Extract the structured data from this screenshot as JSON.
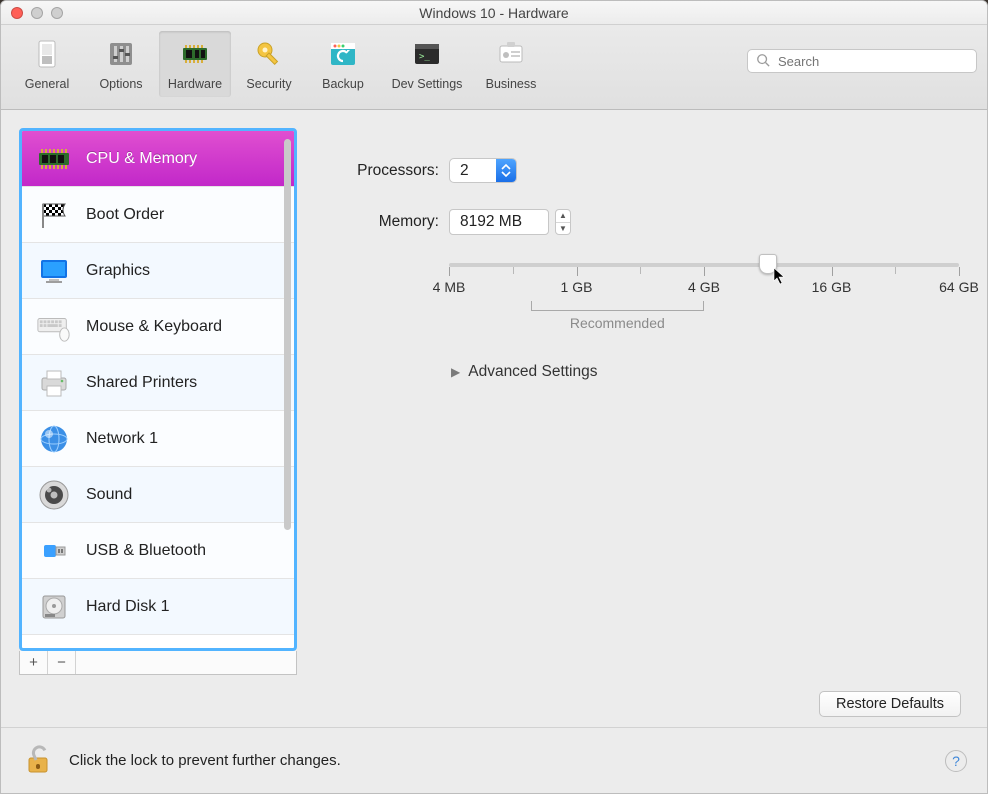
{
  "window": {
    "title": "Windows 10 - Hardware"
  },
  "toolbar": {
    "items": [
      {
        "label": "General",
        "icon": "switch-icon"
      },
      {
        "label": "Options",
        "icon": "sliders-icon"
      },
      {
        "label": "Hardware",
        "icon": "chip-icon",
        "selected": true
      },
      {
        "label": "Security",
        "icon": "key-icon"
      },
      {
        "label": "Backup",
        "icon": "backup-icon"
      },
      {
        "label": "Dev Settings",
        "icon": "terminal-icon"
      },
      {
        "label": "Business",
        "icon": "badge-icon"
      }
    ],
    "search_placeholder": "Search"
  },
  "sidebar": {
    "items": [
      {
        "label": "CPU & Memory",
        "icon": "chip-icon",
        "selected": true
      },
      {
        "label": "Boot Order",
        "icon": "flag-icon"
      },
      {
        "label": "Graphics",
        "icon": "monitor-icon"
      },
      {
        "label": "Mouse & Keyboard",
        "icon": "keyboard-icon"
      },
      {
        "label": "Shared Printers",
        "icon": "printer-icon"
      },
      {
        "label": "Network 1",
        "icon": "globe-icon"
      },
      {
        "label": "Sound",
        "icon": "speaker-icon"
      },
      {
        "label": "USB & Bluetooth",
        "icon": "usb-icon"
      },
      {
        "label": "Hard Disk 1",
        "icon": "hdd-icon"
      }
    ],
    "add_label": "+",
    "remove_label": "−"
  },
  "main": {
    "processors_label": "Processors:",
    "processors_value": "2",
    "memory_label": "Memory:",
    "memory_value": "8192 MB",
    "slider": {
      "ticks": [
        {
          "pos": 0,
          "label": "4 MB",
          "value_mb": 4
        },
        {
          "pos": 0.25,
          "label": "1 GB",
          "value_mb": 1024
        },
        {
          "pos": 0.5,
          "label": "4 GB",
          "value_mb": 4096
        },
        {
          "pos": 0.75,
          "label": "16 GB",
          "value_mb": 16384
        },
        {
          "pos": 1.0,
          "label": "64 GB",
          "value_mb": 65536
        }
      ],
      "thumb_pos": 0.625,
      "recommended": {
        "from": 0.16,
        "to": 0.5,
        "label": "Recommended"
      }
    },
    "advanced_label": "Advanced Settings",
    "restore_label": "Restore Defaults"
  },
  "footer": {
    "lock_text": "Click the lock to prevent further changes.",
    "help_label": "?"
  },
  "colors": {
    "selection_purple": "#c228c9",
    "focus_blue": "#52b4ff",
    "mac_blue": "#1a6fe8"
  }
}
